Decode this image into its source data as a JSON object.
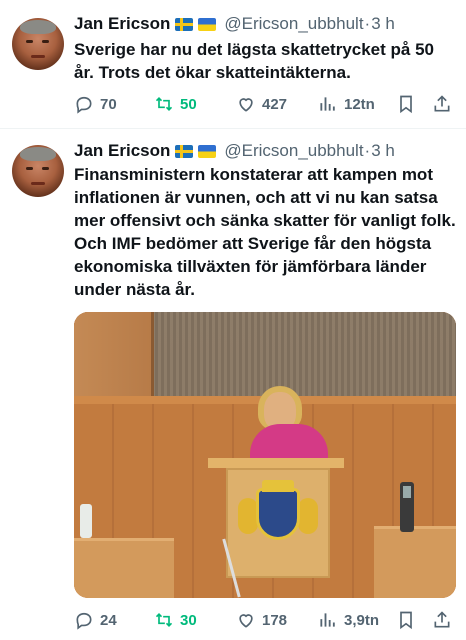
{
  "colors": {
    "text": "#0f1419",
    "muted": "#536471",
    "retweet": "#00ba7c"
  },
  "tweets": [
    {
      "author": "Jan Ericson",
      "flags": [
        "sweden-flag",
        "ukraine-flag"
      ],
      "handle": "@Ericson_ubbhult",
      "separator": "·",
      "time": "3 h",
      "text": "Sverige har nu det lägsta skattetrycket på 50 år. Trots det ökar skatteintäkterna.",
      "replies": "70",
      "retweets": "50",
      "likes": "427",
      "views": "12tn"
    },
    {
      "author": "Jan Ericson",
      "flags": [
        "sweden-flag",
        "ukraine-flag"
      ],
      "handle": "@Ericson_ubbhult",
      "separator": "·",
      "time": "3 h",
      "text": "Finansministern konstaterar att kampen mot inflationen är vunnen, och att vi nu kan satsa mer offensivt och sänka skatter för vanligt folk. Och IMF bedömer att Sverige får den  högsta ekonomiska tillväxten för jämförbara länder under nästa år.",
      "replies": "24",
      "retweets": "30",
      "likes": "178",
      "views": "3,9tn"
    }
  ],
  "icons": [
    "reply-icon",
    "retweet-icon",
    "like-icon",
    "views-icon",
    "bookmark-icon",
    "share-icon"
  ]
}
